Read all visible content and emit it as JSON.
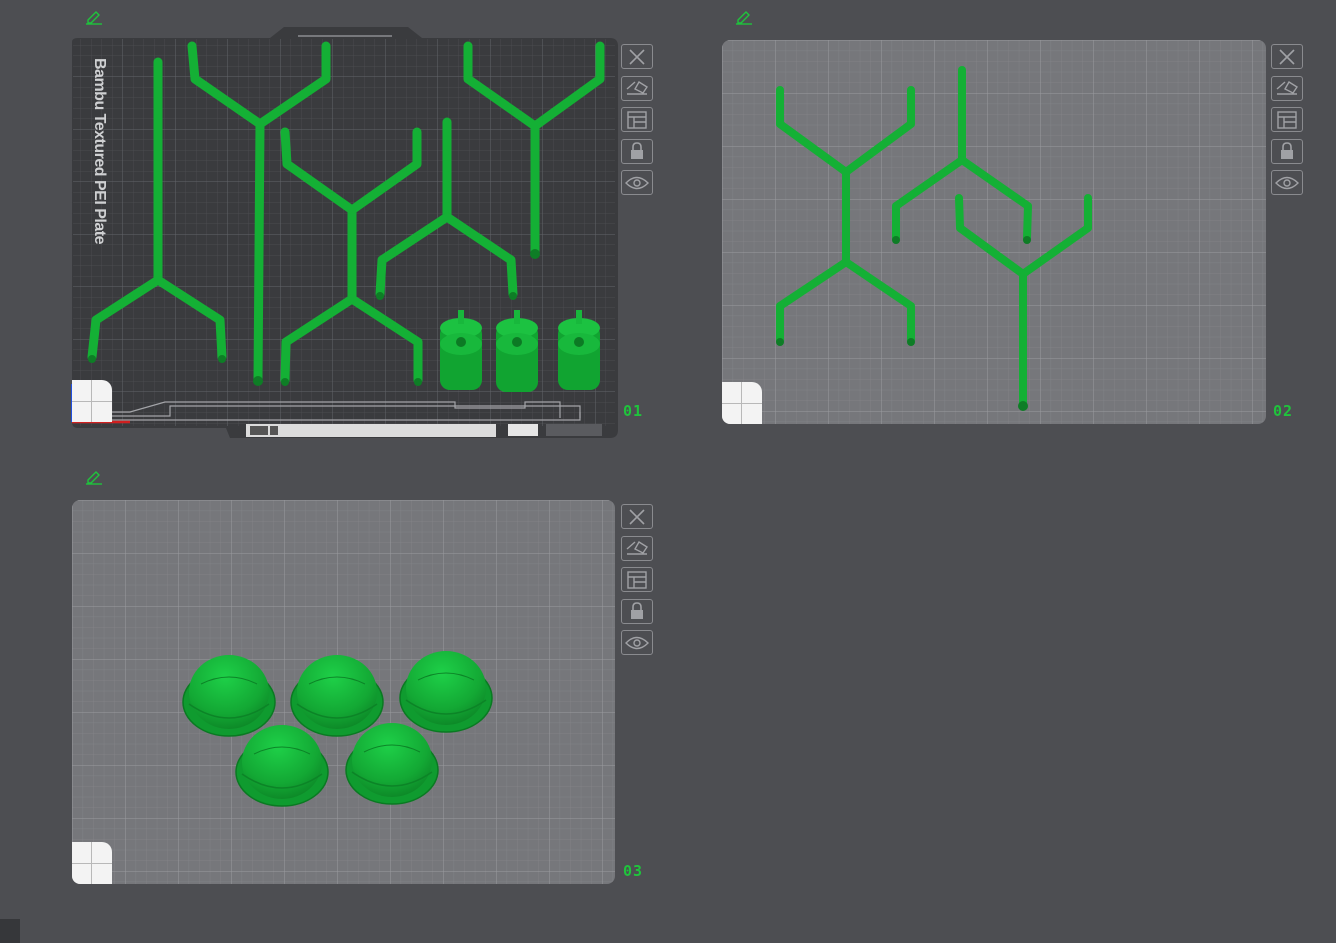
{
  "plates": [
    {
      "number": "01",
      "bed_label": "Bambu Textured PEI Plate",
      "style": "dark"
    },
    {
      "number": "02",
      "bed_label": "",
      "style": "light"
    },
    {
      "number": "03",
      "bed_label": "",
      "style": "light"
    }
  ],
  "tools": [
    {
      "name": "close-icon"
    },
    {
      "name": "auto-orient-icon"
    },
    {
      "name": "arrange-icon"
    },
    {
      "name": "lock-icon"
    },
    {
      "name": "preview-eye-icon"
    }
  ],
  "colors": {
    "background": "#4d4e52",
    "accent_green": "#1fc43c",
    "model_green": "#14b035",
    "dark_plate": "#3a3b3e",
    "light_plate": "#76777b"
  }
}
